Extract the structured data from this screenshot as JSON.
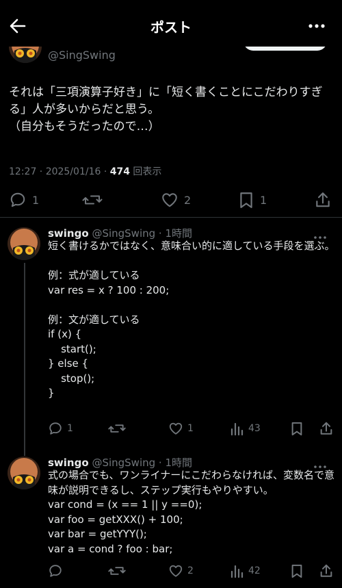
{
  "header": {
    "title": "ポスト"
  },
  "post": {
    "handle": "@SingSwing",
    "text": "それは「三項演算子好き」に「短く書くことにこだわりすぎる」人が多いからだと思う。\n（自分もそうだったので…）",
    "time": "12:27 · 2025/01/16 · ",
    "views_count": "474",
    "views_label": " 回表示",
    "stats": {
      "replies": "1",
      "retweets": "",
      "likes": "2",
      "bookmarks": "1"
    }
  },
  "replies": [
    {
      "name": "swingo",
      "handle": "@SingSwing",
      "time": " · 1時間",
      "text": "短く書けるかではなく、意味合い的に適している手段を選ぶ。\n\n例：式が適している\nvar res = x ? 100 : 200;\n\n例：文が適している\nif (x) {\n    start();\n} else {\n    stop();\n}",
      "stats": {
        "replies": "1",
        "retweets": "",
        "likes": "1",
        "views": "43"
      }
    },
    {
      "name": "swingo",
      "handle": "@SingSwing",
      "time": " · 1時間",
      "text": "式の場合でも、ワンライナーにこだわらなければ、変数名で意味が説明できるし、ステップ実行もやりやすい。\nvar cond = (x == 1 || y ==0);\nvar foo = getXXX() + 100;\nvar bar = getYYY();\nvar a = cond ? foo : bar;",
      "stats": {
        "replies": "",
        "retweets": "",
        "likes": "2",
        "views": "42"
      }
    }
  ],
  "colors": {
    "background": "#000000",
    "text": "#e7e9ea",
    "secondary": "#71767b",
    "divider": "#2f3336"
  }
}
